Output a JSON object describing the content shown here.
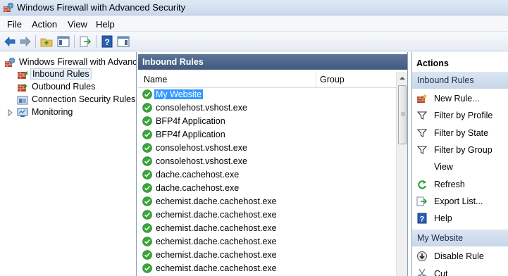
{
  "window": {
    "title": "Windows Firewall with Advanced Security"
  },
  "menu": [
    "File",
    "Action",
    "View",
    "Help"
  ],
  "toolbar": {
    "icons": [
      "back-arrow-icon",
      "forward-arrow-icon",
      "up-folder-icon",
      "show-hide-tree-icon",
      "export-list-icon",
      "help-icon",
      "show-hide-action-pane-icon"
    ]
  },
  "tree": {
    "root": "Windows Firewall with Advanced Security",
    "items": [
      "Inbound Rules",
      "Outbound Rules",
      "Connection Security Rules",
      "Monitoring"
    ],
    "selected": "Inbound Rules"
  },
  "center": {
    "title": "Inbound Rules",
    "columns": [
      "Name",
      "Group"
    ],
    "rows": [
      "My Website",
      "consolehost.vshost.exe",
      "BFP4f Application",
      "BFP4f Application",
      "consolehost.vshost.exe",
      "consolehost.vshost.exe",
      "dache.cachehost.exe",
      "dache.cachehost.exe",
      "echemist.dache.cachehost.exe",
      "echemist.dache.cachehost.exe",
      "echemist.dache.cachehost.exe",
      "echemist.dache.cachehost.exe",
      "echemist.dache.cachehost.exe",
      "echemist.dache.cachehost.exe"
    ],
    "selected_row": 0
  },
  "actions": {
    "title": "Actions",
    "sections": [
      {
        "header": "Inbound Rules",
        "items": [
          {
            "label": "New Rule...",
            "icon": "new-rule-icon"
          },
          {
            "label": "Filter by Profile",
            "icon": "filter-icon"
          },
          {
            "label": "Filter by State",
            "icon": "filter-icon"
          },
          {
            "label": "Filter by Group",
            "icon": "filter-icon"
          },
          {
            "label": "View",
            "icon": ""
          },
          {
            "label": "Refresh",
            "icon": "refresh-icon"
          },
          {
            "label": "Export List...",
            "icon": "export-list-icon"
          },
          {
            "label": "Help",
            "icon": "help-icon"
          }
        ]
      },
      {
        "header": "My Website",
        "items": [
          {
            "label": "Disable Rule",
            "icon": "disable-rule-icon"
          },
          {
            "label": "Cut",
            "icon": "cut-icon"
          }
        ]
      }
    ]
  },
  "colors": {
    "header_blue": "#4a6386",
    "selection": "#3399ff",
    "check_green": "#3aa63a"
  }
}
